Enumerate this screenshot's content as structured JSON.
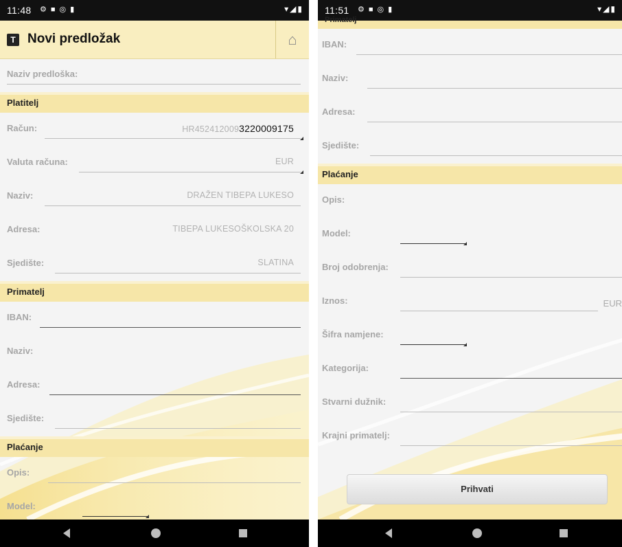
{
  "left": {
    "status_time": "11:48",
    "title": "Novi predložak",
    "template_name_label": "Naziv predloška:",
    "payer_section": "Platitelj",
    "account_label": "Račun:",
    "account_prefix": "HR452412009",
    "account_suffix": "3220009175",
    "currency_label": "Valuta računa:",
    "currency_value": "EUR",
    "name_label": "Naziv:",
    "name_value": "DRAŽEN TIBEPA LUKESO",
    "address_label": "Adresa:",
    "address_value": "TIBEPA LUKESOŠKOLSKA 20",
    "seat_label": "Sjedište:",
    "seat_value": "SLATINA",
    "recipient_section": "Primatelj",
    "iban_label": "IBAN:",
    "r_name_label": "Naziv:",
    "r_address_label": "Adresa:",
    "r_seat_label": "Sjedište:",
    "payment_section": "Plaćanje",
    "desc_label": "Opis:",
    "model_label": "Model:"
  },
  "right": {
    "status_time": "11:51",
    "cut_section": "Primatelj",
    "iban_label": "IBAN:",
    "name_label": "Naziv:",
    "address_label": "Adresa:",
    "seat_label": "Sjedište:",
    "payment_section": "Plaćanje",
    "desc_label": "Opis:",
    "model_label": "Model:",
    "approval_label": "Broj odobrenja:",
    "amount_label": "Iznos:",
    "amount_unit": "EUR",
    "purpose_label": "Šifra namjene:",
    "category_label": "Kategorija:",
    "debtor_label": "Stvarni dužnik:",
    "final_recipient_label": "Krajni primatelj:",
    "accept_button": "Prihvati"
  },
  "icons": [
    "settings-icon",
    "notification-icon",
    "vpn-icon",
    "sd-card-icon",
    "wifi-icon",
    "signal-icon",
    "battery-icon",
    "home-icon",
    "back-icon",
    "home-nav-icon",
    "recents-icon"
  ],
  "colors": {
    "header": "#f9eec0",
    "section": "#f6e6a8",
    "nav": "#000000"
  }
}
